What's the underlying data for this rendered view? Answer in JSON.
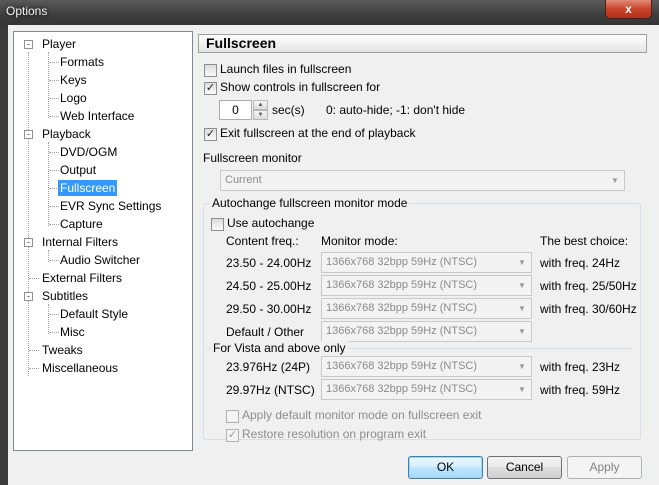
{
  "window": {
    "title": "Options",
    "close_glyph": "x"
  },
  "tree": {
    "items": [
      {
        "label": "Player",
        "expander": "-"
      },
      {
        "label": "Formats"
      },
      {
        "label": "Keys"
      },
      {
        "label": "Logo"
      },
      {
        "label": "Web Interface"
      },
      {
        "label": "Playback",
        "expander": "-"
      },
      {
        "label": "DVD/OGM"
      },
      {
        "label": "Output"
      },
      {
        "label": "Fullscreen",
        "selected": true
      },
      {
        "label": "EVR Sync Settings"
      },
      {
        "label": "Capture"
      },
      {
        "label": "Internal Filters",
        "expander": "-"
      },
      {
        "label": "Audio Switcher"
      },
      {
        "label": "External Filters"
      },
      {
        "label": "Subtitles",
        "expander": "-"
      },
      {
        "label": "Default Style"
      },
      {
        "label": "Misc"
      },
      {
        "label": "Tweaks"
      },
      {
        "label": "Miscellaneous"
      }
    ]
  },
  "page": {
    "title": "Fullscreen",
    "launch_fullscreen": {
      "label": "Launch files in fullscreen",
      "checked": false
    },
    "show_controls": {
      "label": "Show controls in fullscreen for",
      "checked": true
    },
    "controls_seconds": "0",
    "seconds_unit": "sec(s)",
    "seconds_hint": "0: auto-hide; -1: don't hide",
    "exit_fullscreen": {
      "label": "Exit fullscreen at the end of playback",
      "checked": true
    },
    "monitor_label": "Fullscreen monitor",
    "monitor_value": "Current",
    "autochange": {
      "group_title": "Autochange fullscreen monitor mode",
      "use_autochange": {
        "label": "Use autochange",
        "checked": false
      },
      "col_content": "Content freq.:",
      "col_monitor": "Monitor mode:",
      "col_best": "The best choice:",
      "rows": [
        {
          "content": "23.50 - 24.00Hz",
          "mode": "1366x768 32bpp 59Hz (NTSC)",
          "best": "with freq. 24Hz"
        },
        {
          "content": "24.50 - 25.00Hz",
          "mode": "1366x768 32bpp 59Hz (NTSC)",
          "best": "with freq. 25/50Hz"
        },
        {
          "content": "29.50 - 30.00Hz",
          "mode": "1366x768 32bpp 59Hz (NTSC)",
          "best": "with freq. 30/60Hz"
        },
        {
          "content": "Default / Other",
          "mode": "1366x768 32bpp 59Hz (NTSC)",
          "best": ""
        }
      ],
      "vista_title": "For Vista and above only",
      "vista_rows": [
        {
          "content": "23.976Hz (24P)",
          "mode": "1366x768 32bpp 59Hz (NTSC)",
          "best": "with freq. 23Hz"
        },
        {
          "content": "29.97Hz (NTSC)",
          "mode": "1366x768 32bpp 59Hz (NTSC)",
          "best": "with freq. 59Hz"
        }
      ],
      "apply_default": {
        "label": "Apply default monitor mode on fullscreen exit",
        "checked": false
      },
      "restore_resolution": {
        "label": "Restore resolution on program exit",
        "checked": true
      }
    }
  },
  "buttons": {
    "ok": "OK",
    "cancel": "Cancel",
    "apply": "Apply"
  },
  "glyphs": {
    "check": "✓",
    "up": "▲",
    "down": "▼",
    "combo_arrow": "▼"
  }
}
